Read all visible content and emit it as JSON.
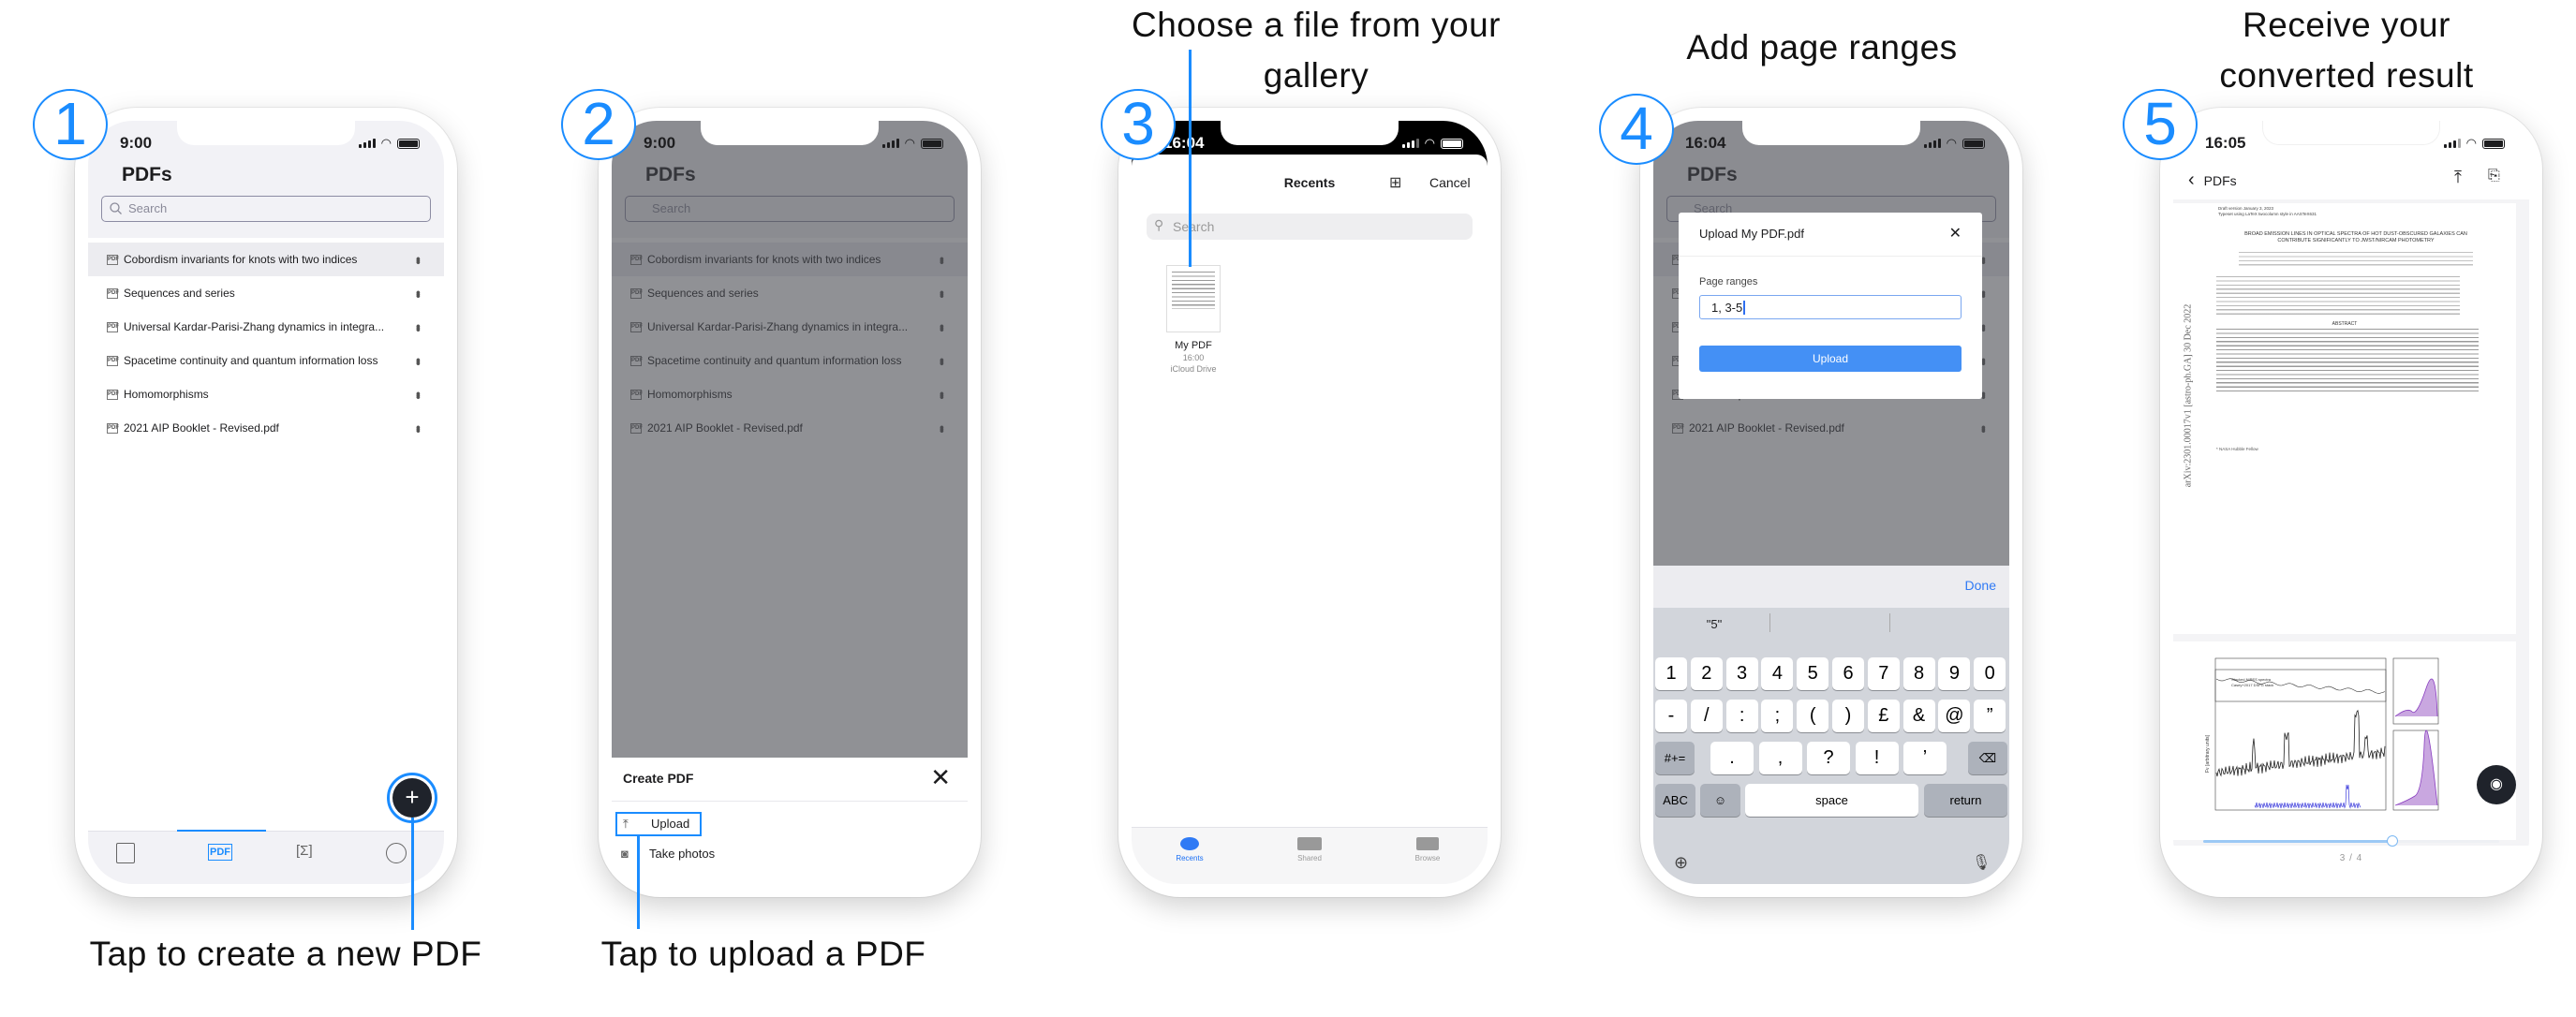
{
  "accent": "#1a8cff",
  "captions": {
    "step1": "Tap to create a new PDF",
    "step2": "Tap to upload a PDF",
    "step3": "Choose a file from your gallery",
    "step4": "Add page ranges",
    "step5": "Receive your converted result"
  },
  "steps": [
    "1",
    "2",
    "3",
    "4",
    "5"
  ],
  "pdf_list": {
    "title": "PDFs",
    "search_placeholder": "Search",
    "file_icon": "PDF",
    "items": [
      "Cobordism invariants for knots with two indices",
      "Sequences and series",
      "Universal Kardar-Parisi-Zhang dynamics in integra...",
      "Spacetime continuity and quantum information loss",
      "Homomorphisms",
      "2021 AIP Booklet - Revised.pdf"
    ]
  },
  "phone1": {
    "time": "9:00",
    "tabs": [
      "document-icon",
      "pdf-icon",
      "formula-icon",
      "profile-icon"
    ],
    "active_tab": 1,
    "tab_pdf_label": "PDF"
  },
  "phone2": {
    "time": "9:00",
    "sheet": {
      "title": "Create PDF",
      "upload": "Upload",
      "take_photos": "Take photos"
    }
  },
  "phone3": {
    "time": "16:04",
    "title": "Recents",
    "cancel": "Cancel",
    "search_placeholder": "Search",
    "file": {
      "name": "My PDF",
      "time": "16:00",
      "location": "iCloud Drive"
    },
    "tabs": [
      "Recents",
      "Shared",
      "Browse"
    ]
  },
  "phone4": {
    "time": "16:04",
    "modal": {
      "title": "Upload My PDF.pdf",
      "label": "Page ranges",
      "value": "1, 3-5",
      "button": "Upload"
    },
    "keyboard": {
      "done": "Done",
      "suggestion": "\"5\"",
      "row1": [
        "1",
        "2",
        "3",
        "4",
        "5",
        "6",
        "7",
        "8",
        "9",
        "0"
      ],
      "row2": [
        "-",
        "/",
        ":",
        ";",
        "(",
        ")",
        "£",
        "&",
        "@",
        "”"
      ],
      "row3": [
        ".",
        ",",
        "?",
        "!",
        "’"
      ],
      "symbols": "#+=",
      "abc": "ABC",
      "space": "space",
      "return": "return"
    }
  },
  "phone5": {
    "time": "16:05",
    "back": "PDFs",
    "page_indicator": "3 / 4",
    "slider_progress": 0.64,
    "paper": {
      "header1": "Draft version January 3, 2023",
      "header2": "Typeset using LaTeX twocolumn style in AASTeX631",
      "title": "BROAD EMISSION LINES IN OPTICAL SPECTRA OF HOT DUST-OBSCURED GALAXIES CAN CONTRIBUTE SIGNIFICANTLY TO JWST/NIRCAM PHOTOMETRY",
      "arxiv_id": "arXiv:2301.00017v1 [astro-ph.GA] 30 Dec 2022",
      "abstract_heading": "ABSTRACT",
      "footnote": "* NASA Hubble Fellow",
      "figure_legend1": "Stacked NIRES spectra",
      "figure_legend2": "Casey+2017 DSFG stack",
      "figure_ylabel": "Fν [arbitrary units]"
    }
  }
}
